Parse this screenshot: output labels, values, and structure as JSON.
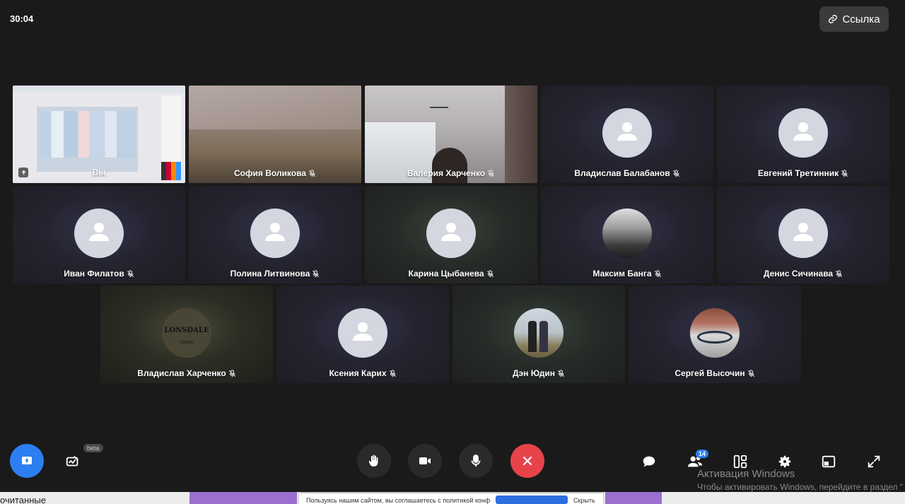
{
  "header": {
    "timer": "30:04",
    "link_label": "Ссылка"
  },
  "participants": {
    "self": "Вы",
    "p1": "София Воликова",
    "p2": "Валерия Харченко",
    "p3": "Владислав Балабанов",
    "p4": "Евгений Третинник",
    "p5": "Иван Филатов",
    "p6": "Полина Литвинова",
    "p7": "Карина Цыбанева",
    "p8": "Максим Банга",
    "p9": "Денис Сичинава",
    "p10": "Владислав Харченко",
    "p11": "Ксения Карих",
    "p12": "Дэн Юдин",
    "p13": "Сергей Высочин"
  },
  "avatars": {
    "lonsdale_text": "LONSDALE",
    "lonsdale_sub": "LONDON"
  },
  "toolbar": {
    "beta_label": "beta",
    "participants_count": "14"
  },
  "windows": {
    "title": "Активация Windows",
    "subtitle": "Чтобы активировать Windows, перейдите в раздел \""
  },
  "background": {
    "strip_text": "очитанные",
    "cookie_text": "Пользуясь нашим сайтом, вы соглашаетесь с политикой конф",
    "cookie_hide": "Скрыть"
  },
  "colors": {
    "accent": "#2d7ef0",
    "end_call": "#e8434b",
    "button": "#2a2a2a"
  }
}
